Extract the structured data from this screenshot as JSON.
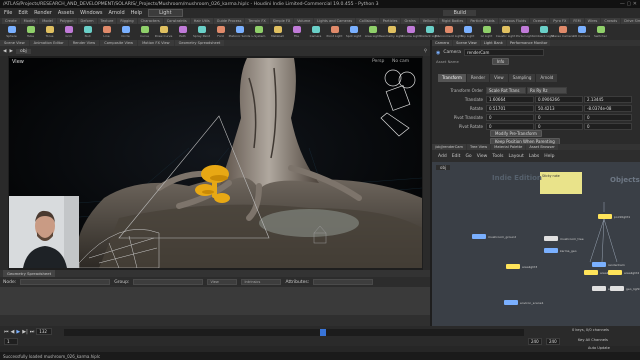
{
  "window": {
    "title": "/ATLAS/Projects/RESEARCH_AND_DEVELOPMENT/SOLARIS/_Projects/Mushroom/mushroom_026_karma.hiplc - Houdini Indie Limited-Commercial 19.0.455 - Python 3"
  },
  "menubar": {
    "items": [
      "File",
      "Edit",
      "Render",
      "Assets",
      "Windows",
      "Arnold",
      "Help"
    ],
    "desktop": "Light",
    "build_label": "Build"
  },
  "shelf_tabs": [
    "Create",
    "Modify",
    "Model",
    "Polygon",
    "Deform",
    "Texture",
    "Rigging",
    "Characters",
    "Constraints",
    "Hair Utils",
    "Guide Process",
    "Terrain FX",
    "Simple FX",
    "Volume",
    "Lights and Cameras",
    "Collisions",
    "Particles",
    "Grains",
    "Vellum",
    "Rigid Bodies",
    "Particle Fluids",
    "Viscous Fluids",
    "Oceans",
    "Pyro FX",
    "FEM",
    "Wires",
    "Crowds",
    "Drive Simulation"
  ],
  "shelf_tools": [
    "Sphere",
    "Tube",
    "Torus",
    "Grid",
    "Null",
    "Line",
    "Circle",
    "Curve",
    "Draw Curve",
    "Path",
    "Spray Paint",
    "Font",
    "Platonic Solids",
    "L-System",
    "Metaball",
    "File",
    "Camera",
    "Point Light",
    "Spot Light",
    "Area Light",
    "Geometry Light",
    "Volume Light",
    "Distant Light",
    "Environment Light",
    "Sky Light",
    "GI Light",
    "Caustic Light",
    "Portal Light",
    "Ambient Light",
    "Stereo Camera",
    "VR Camera",
    "Switcher"
  ],
  "left_tabs": [
    "Scene View",
    "Animation Editor",
    "Render View",
    "Composite View",
    "Motion FX View",
    "Geometry Spreadsheet"
  ],
  "viewport": {
    "obj_path": "obj",
    "label": "View",
    "persp_label": "Persp",
    "cam_label": "No cam"
  },
  "bottom_tabs": {
    "label": "Geometry Spreadsheet"
  },
  "nodes_bar": {
    "label": "Node:",
    "group_label": "Group:",
    "view_label": "View",
    "intrinsics_label": "Intrinsics",
    "attributes_label": "Attributes:"
  },
  "timeline": {
    "frame": "132",
    "start": "1",
    "end": "240",
    "range_end": "240",
    "keys_label": "0 keys, 0/0 channels",
    "key_all_label": "Key All Channels",
    "auto_label": "Auto Update"
  },
  "status": {
    "text": "Successfully loaded mushroom_026_karma.hiplc"
  },
  "right_tabs": [
    "Camera",
    "Scene View",
    "Light Bank",
    "Performance Monitor"
  ],
  "parm_header": {
    "node_type": "Camera",
    "node_name": "renderCam",
    "asset_label": "Asset Name",
    "info_label": "Info"
  },
  "parm_tabs": [
    "Transform",
    "Render",
    "View",
    "Sampling",
    "Arnold"
  ],
  "parms": [
    {
      "label": "Transform Order",
      "values": [
        "Scale Rot Trans",
        "Rx Ry Rz"
      ]
    },
    {
      "label": "Translate",
      "values": [
        "1.60664",
        "0.0906266",
        "2.13445"
      ]
    },
    {
      "label": "Rotate",
      "values": [
        "0.51701",
        "50.4213",
        "-8.0374e-08"
      ]
    },
    {
      "label": "Pivot Translate",
      "values": [
        "0",
        "0",
        "0"
      ]
    },
    {
      "label": "Pivot Rotate",
      "values": [
        "0",
        "0",
        "0"
      ]
    }
  ],
  "parm_buttons": [
    "Modify Pre-Transform",
    "Keep Position When Parenting"
  ],
  "network_tabs": [
    "/obj/renderCam",
    "Tree View",
    "Material Palette",
    "Asset Browser"
  ],
  "network_menu": [
    "Add",
    "Edit",
    "Go",
    "View",
    "Tools",
    "Layout",
    "Labs",
    "Help"
  ],
  "network": {
    "path": "obj",
    "context_label": "Objects",
    "sticky_text": "Sticky note",
    "indie_label": "Indie Edition",
    "nodes": [
      {
        "name": "mushroom_ground",
        "color": "#7ab0ff"
      },
      {
        "name": "mushroom_tree",
        "color": "#e0e0e0"
      },
      {
        "name": "pointlight1",
        "color": "#ffe45a"
      },
      {
        "name": "karma_geo",
        "color": "#7ab0ff"
      },
      {
        "name": "environ_scene1",
        "color": "#7ab0ff"
      },
      {
        "name": "renderCam",
        "color": "#7ab0ff"
      },
      {
        "name": "arealight1",
        "color": "#ffe45a"
      },
      {
        "name": "arealight2",
        "color": "#ffe45a"
      },
      {
        "name": "arealight3",
        "color": "#ffe45a"
      },
      {
        "name": "skyLight",
        "color": "#e0e0e0"
      },
      {
        "name": "geo_light",
        "color": "#e0e0e0"
      }
    ]
  },
  "colors": {
    "accent": "#3874d8",
    "node_selected": "#ffe45a",
    "mushroom": "#e8a814",
    "sticky": "#e9e38a"
  }
}
